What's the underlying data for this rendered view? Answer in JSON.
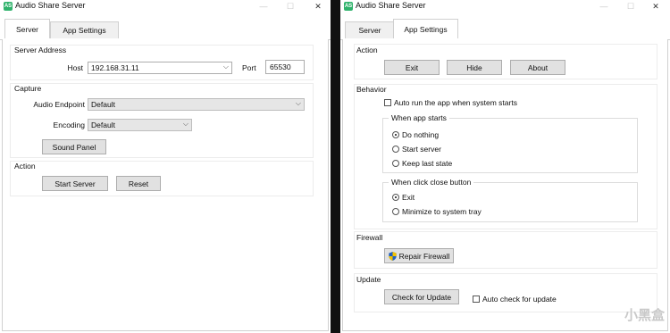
{
  "windows": {
    "left": {
      "title": "Audio Share Server",
      "icon_text": "AS",
      "controls": {
        "minimize": "—",
        "maximize": "☐",
        "close": "✕"
      },
      "tabs": [
        {
          "label": "Server",
          "active": true
        },
        {
          "label": "App Settings",
          "active": false
        }
      ],
      "server_address": {
        "title": "Server Address",
        "host_label": "Host",
        "host_value": "192.168.31.11",
        "port_label": "Port",
        "port_value": "65530"
      },
      "capture": {
        "title": "Capture",
        "endpoint_label": "Audio Endpoint",
        "endpoint_value": "Default",
        "encoding_label": "Encoding",
        "encoding_value": "Default",
        "sound_panel_label": "Sound Panel"
      },
      "action": {
        "title": "Action",
        "start_label": "Start Server",
        "reset_label": "Reset"
      }
    },
    "right": {
      "title": "Audio Share Server",
      "icon_text": "AS",
      "controls": {
        "minimize": "—",
        "maximize": "☐",
        "close": "✕"
      },
      "tabs": [
        {
          "label": "Server",
          "active": false
        },
        {
          "label": "App Settings",
          "active": true
        }
      ],
      "action": {
        "title": "Action",
        "exit_label": "Exit",
        "hide_label": "Hide",
        "about_label": "About"
      },
      "behavior": {
        "title": "Behavior",
        "autorun_label": "Auto run the app when system starts",
        "autorun_checked": false,
        "when_app_starts": {
          "title": "When app starts",
          "options": [
            {
              "label": "Do nothing",
              "selected": true
            },
            {
              "label": "Start server",
              "selected": false
            },
            {
              "label": "Keep last state",
              "selected": false
            }
          ]
        },
        "when_click_close": {
          "title": "When click close button",
          "options": [
            {
              "label": "Exit",
              "selected": true
            },
            {
              "label": "Minimize to system tray",
              "selected": false
            }
          ]
        }
      },
      "firewall": {
        "title": "Firewall",
        "repair_label": "Repair Firewall"
      },
      "update": {
        "title": "Update",
        "check_label": "Check for Update",
        "auto_check_label": "Auto check for update",
        "auto_check_checked": false
      }
    }
  },
  "watermark": "小黑盒",
  "colors": {
    "app_icon": "#2fb26b",
    "divider": "#111111",
    "button_face": "#e1e1e1"
  }
}
